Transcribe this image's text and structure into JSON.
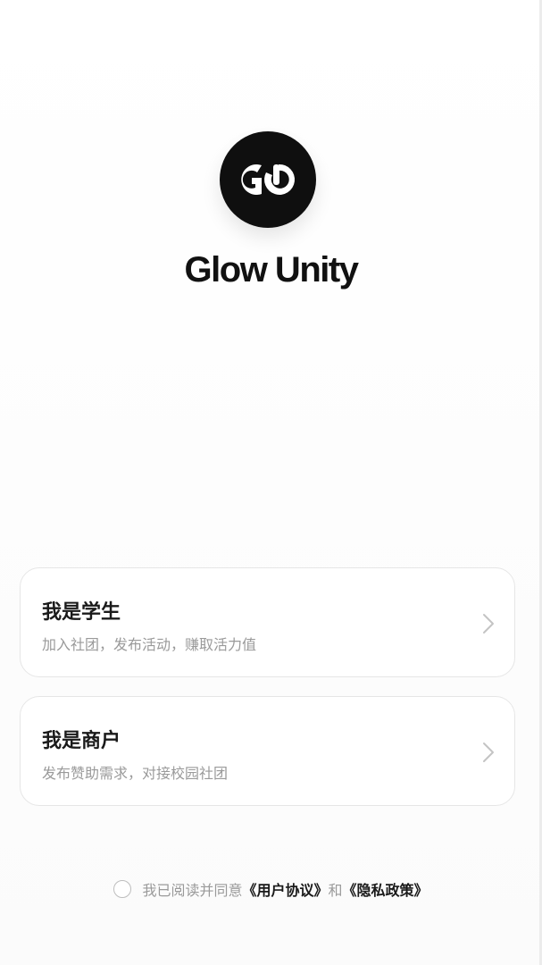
{
  "app": {
    "name": "Glow Unity",
    "logo_text": "GO"
  },
  "roles": [
    {
      "title": "我是学生",
      "description": "加入社团，发布活动，赚取活力值"
    },
    {
      "title": "我是商户",
      "description": "发布赞助需求，对接校园社团"
    }
  ],
  "agreement": {
    "prefix": "我已阅读并同意",
    "user_agreement": "《用户协议》",
    "connector": "和",
    "privacy_policy": "《隐私政策》"
  },
  "icons": {
    "logo": "glow-unity-logo-icon",
    "chevron": "chevron-right-icon",
    "checkbox": "radio-circle-icon"
  },
  "colors": {
    "logo_bg": "#0f0f0f",
    "title_text": "#1a1a1a",
    "muted_text": "#9a9a9a",
    "card_border": "#e6e6e6"
  }
}
